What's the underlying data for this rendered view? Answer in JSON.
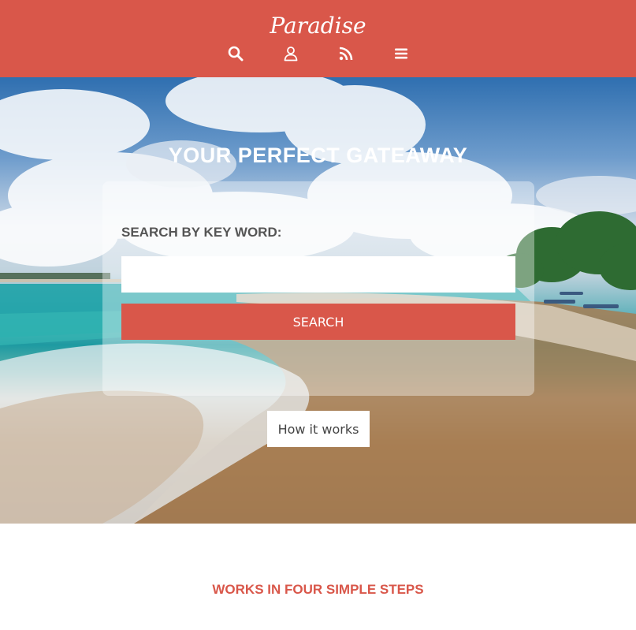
{
  "header": {
    "logo": "Paradise",
    "bg_color": "#d9574a",
    "icons": [
      "search-icon",
      "user-icon",
      "rss-icon",
      "menu-icon"
    ]
  },
  "hero": {
    "title": "YOUR PERFECT GATEAWAY",
    "search_label": "SEARCH BY KEY WORD:",
    "search_value": "",
    "search_placeholder": "",
    "search_button": "SEARCH",
    "how_button": "How it works"
  },
  "steps": {
    "title": "WORKS IN FOUR SIMPLE STEPS"
  }
}
